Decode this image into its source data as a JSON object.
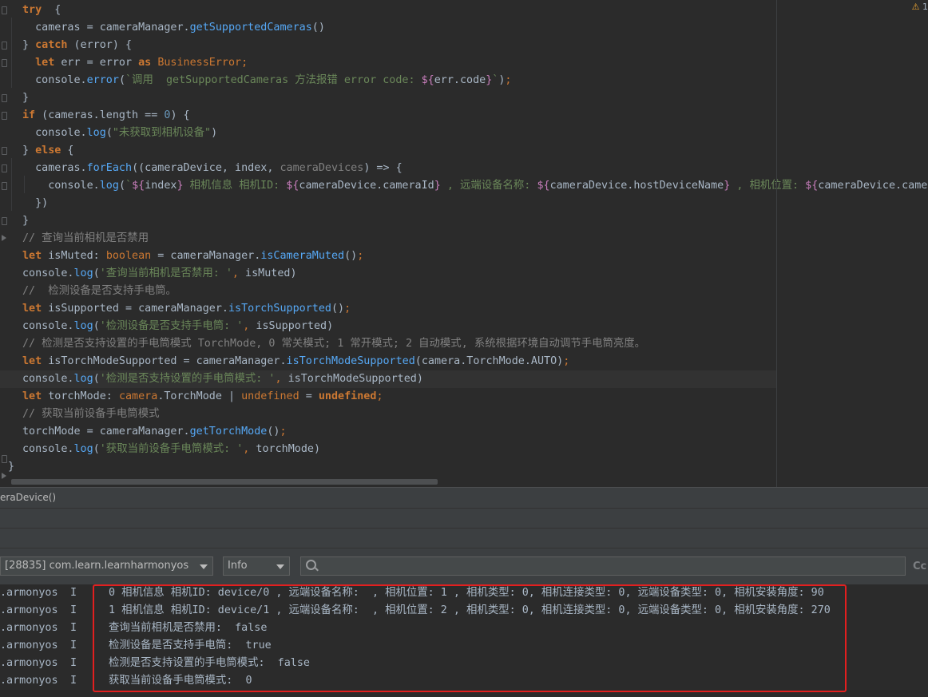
{
  "editor": {
    "warning_count": "1",
    "code_lines": [
      [
        [
          "kw",
          "try"
        ],
        [
          "",
          "  {"
        ]
      ],
      [
        [
          "",
          "  cameras = cameraManager."
        ],
        [
          "fn",
          "getSupportedCameras"
        ],
        [
          "",
          "()"
        ]
      ],
      [
        [
          "",
          "} "
        ],
        [
          "kw",
          "catch"
        ],
        [
          "",
          " (error) {"
        ]
      ],
      [
        [
          "",
          "  "
        ],
        [
          "kw",
          "let"
        ],
        [
          "",
          " err = error "
        ],
        [
          "kw",
          "as"
        ],
        [
          "",
          " "
        ],
        [
          "typ",
          "BusinessError"
        ],
        [
          "kwp",
          ";"
        ]
      ],
      [
        [
          "",
          "  console."
        ],
        [
          "fn",
          "error"
        ],
        [
          "",
          "("
        ],
        [
          "str",
          "`调用  getSupportedCameras 方法报错 error code: "
        ],
        [
          "tpl",
          "${"
        ],
        [
          "",
          "err.code"
        ],
        [
          "tpl",
          "}"
        ],
        [
          "str",
          "`"
        ],
        [
          "",
          ")"
        ],
        [
          "kwp",
          ";"
        ]
      ],
      [
        [
          "",
          "}"
        ]
      ],
      [
        [
          "kw",
          "if"
        ],
        [
          "",
          " (cameras.length == "
        ],
        [
          "num",
          "0"
        ],
        [
          "",
          ") {"
        ]
      ],
      [
        [
          "",
          "  console."
        ],
        [
          "fn",
          "log"
        ],
        [
          "",
          "("
        ],
        [
          "str",
          "\"未获取到相机设备\""
        ],
        [
          "",
          ")"
        ]
      ],
      [
        [
          "",
          "} "
        ],
        [
          "kw",
          "else"
        ],
        [
          "",
          " {"
        ]
      ],
      [
        [
          "",
          "  cameras."
        ],
        [
          "fn",
          "forEach"
        ],
        [
          "",
          "((cameraDevice, index, "
        ],
        [
          "prm",
          "cameraDevices"
        ],
        [
          "",
          ") => {"
        ]
      ],
      [
        [
          "",
          "    console."
        ],
        [
          "fn",
          "log"
        ],
        [
          "",
          "("
        ],
        [
          "str",
          "`"
        ],
        [
          "tpl",
          "${"
        ],
        [
          "",
          "index"
        ],
        [
          "tpl",
          "}"
        ],
        [
          "str",
          " 相机信息 相机ID: "
        ],
        [
          "tpl",
          "${"
        ],
        [
          "",
          "cameraDevice.cameraId"
        ],
        [
          "tpl",
          "}"
        ],
        [
          "str",
          " , 远端设备名称: "
        ],
        [
          "tpl",
          "${"
        ],
        [
          "",
          "cameraDevice.hostDeviceName"
        ],
        [
          "tpl",
          "}"
        ],
        [
          "str",
          " , 相机位置: "
        ],
        [
          "tpl",
          "${"
        ],
        [
          "",
          "cameraDevice.cameraPosition"
        ]
      ],
      [
        [
          "",
          "  })"
        ]
      ],
      [
        [
          "",
          "}"
        ]
      ],
      [
        [
          "cmt",
          "// 查询当前相机是否禁用"
        ]
      ],
      [
        [
          "kw",
          "let"
        ],
        [
          "",
          " isMuted: "
        ],
        [
          "typ",
          "boolean"
        ],
        [
          "",
          " = cameraManager."
        ],
        [
          "fn",
          "isCameraMuted"
        ],
        [
          "",
          "()"
        ],
        [
          "kwp",
          ";"
        ]
      ],
      [
        [
          "",
          "console."
        ],
        [
          "fn",
          "log"
        ],
        [
          "",
          "("
        ],
        [
          "str",
          "'查询当前相机是否禁用: '"
        ],
        [
          "kwp",
          ","
        ],
        [
          "",
          " isMuted)"
        ]
      ],
      [
        [
          "cmt",
          "//  检测设备是否支持手电筒。"
        ]
      ],
      [
        [
          "kw",
          "let"
        ],
        [
          "",
          " isSupported = cameraManager."
        ],
        [
          "fn",
          "isTorchSupported"
        ],
        [
          "",
          "()"
        ],
        [
          "kwp",
          ";"
        ]
      ],
      [
        [
          "",
          "console."
        ],
        [
          "fn",
          "log"
        ],
        [
          "",
          "("
        ],
        [
          "str",
          "'检测设备是否支持手电筒: '"
        ],
        [
          "kwp",
          ","
        ],
        [
          "",
          " isSupported)"
        ]
      ],
      [
        [
          "cmt",
          "// 检测是否支持设置的手电筒模式 TorchMode, 0 常关模式; 1 常开模式; 2 自动模式, 系统根据环境自动调节手电筒亮度。"
        ]
      ],
      [
        [
          "kw",
          "let"
        ],
        [
          "",
          " isTorchModeSupported = cameraManager."
        ],
        [
          "fn",
          "isTorchModeSupported"
        ],
        [
          "",
          "(camera.TorchMode.AUTO)"
        ],
        [
          "kwp",
          ";"
        ]
      ],
      [
        [
          "",
          "console."
        ],
        [
          "fn",
          "log"
        ],
        [
          "",
          "("
        ],
        [
          "str",
          "'检测是否支持设置的手电筒模式: '"
        ],
        [
          "kwp",
          ","
        ],
        [
          "",
          " isTorchModeSupported)"
        ]
      ],
      [
        [
          "kw",
          "let"
        ],
        [
          "",
          " torchMode: "
        ],
        [
          "typ",
          "camera"
        ],
        [
          "",
          ".TorchMode | "
        ],
        [
          "typ",
          "undefined"
        ],
        [
          "",
          " = "
        ],
        [
          "kw",
          "undefined"
        ],
        [
          "kwp",
          ";"
        ]
      ],
      [
        [
          "cmt",
          "// 获取当前设备手电筒模式"
        ]
      ],
      [
        [
          "",
          "torchMode = cameraManager."
        ],
        [
          "fn",
          "getTorchMode"
        ],
        [
          "",
          "()"
        ],
        [
          "kwp",
          ";"
        ]
      ],
      [
        [
          "",
          "console."
        ],
        [
          "fn",
          "log"
        ],
        [
          "",
          "("
        ],
        [
          "str",
          "'获取当前设备手电筒模式: '"
        ],
        [
          "kwp",
          ","
        ],
        [
          "",
          " torchMode)"
        ]
      ]
    ],
    "closing_brace": "}"
  },
  "breadcrumb": {
    "label": "eraDevice()"
  },
  "log_toolbar": {
    "process_select": "[28835] com.learn.learnharmonyos",
    "level_select": "Info",
    "search_placeholder": "",
    "cc_label": "Cc"
  },
  "log": {
    "rows": [
      {
        "tag": ".armonyos",
        "level": "I",
        "message": "0 相机信息 相机ID: device/0 , 远端设备名称:  , 相机位置: 1 , 相机类型: 0, 相机连接类型: 0, 远端设备类型: 0, 相机安装角度: 90"
      },
      {
        "tag": ".armonyos",
        "level": "I",
        "message": "1 相机信息 相机ID: device/1 , 远端设备名称:  , 相机位置: 2 , 相机类型: 0, 相机连接类型: 0, 远端设备类型: 0, 相机安装角度: 270"
      },
      {
        "tag": ".armonyos",
        "level": "I",
        "message": "查询当前相机是否禁用:  false"
      },
      {
        "tag": ".armonyos",
        "level": "I",
        "message": "检测设备是否支持手电筒:  true"
      },
      {
        "tag": ".armonyos",
        "level": "I",
        "message": "检测是否支持设置的手电筒模式:  false"
      },
      {
        "tag": ".armonyos",
        "level": "I",
        "message": "获取当前设备手电筒模式:  0"
      }
    ],
    "highlight_color": "#e21f1f"
  },
  "colors": {
    "background": "#2b2b2b",
    "keyword": "#cc7832",
    "function": "#56a8f5",
    "string": "#6a8759",
    "comment": "#808080",
    "number": "#6897bb"
  }
}
